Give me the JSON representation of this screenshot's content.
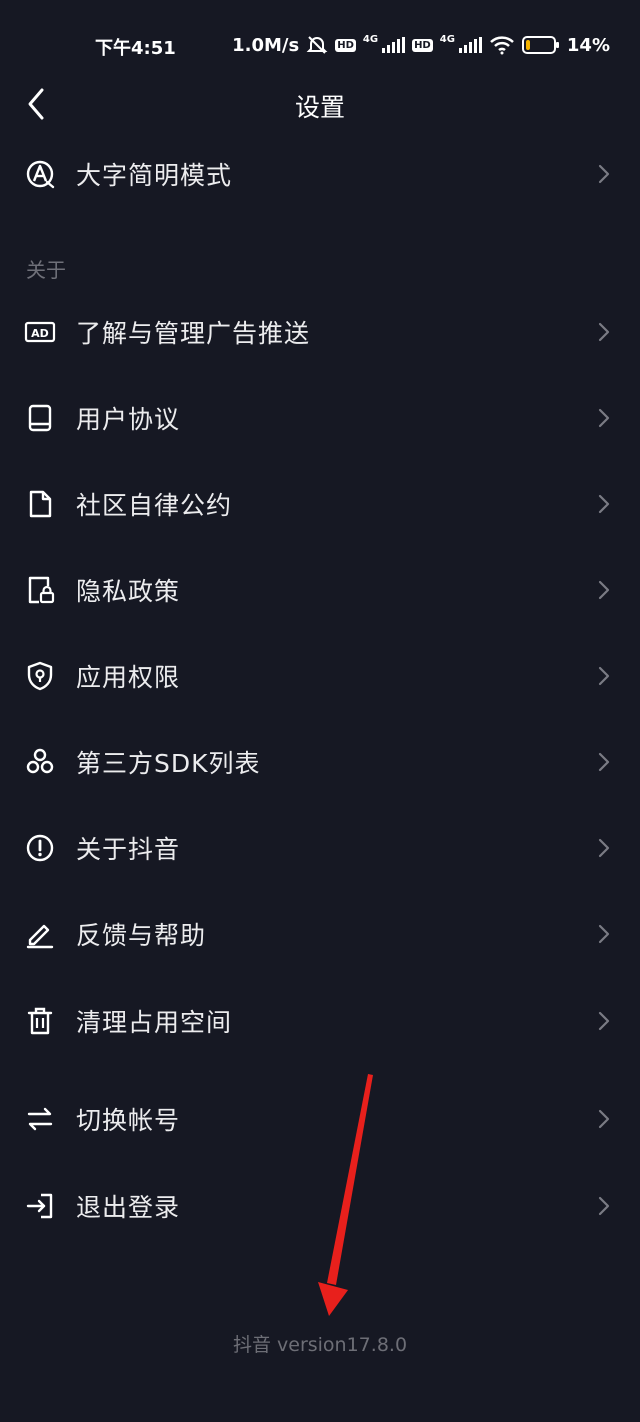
{
  "status_bar": {
    "time": "下午4:51",
    "net_speed": "1.0M/s",
    "sim1_label": "4G",
    "sim2_label": "4G",
    "hd_label": "HD",
    "battery": "14%",
    "battery_level": 0.14,
    "battery_color": "#f5b400"
  },
  "header": {
    "title": "设置"
  },
  "rows_top": [
    {
      "label": "大字简明模式",
      "icon": "large-text-icon"
    }
  ],
  "section_about": {
    "label": "关于"
  },
  "rows_about": [
    {
      "label": "了解与管理广告推送",
      "icon": "ad-icon"
    },
    {
      "label": "用户协议",
      "icon": "book-icon"
    },
    {
      "label": "社区自律公约",
      "icon": "document-icon"
    },
    {
      "label": "隐私政策",
      "icon": "privacy-lock-icon"
    },
    {
      "label": "应用权限",
      "icon": "shield-icon"
    },
    {
      "label": "第三方SDK列表",
      "icon": "sdk-nodes-icon"
    },
    {
      "label": "关于抖音",
      "icon": "info-icon"
    },
    {
      "label": "反馈与帮助",
      "icon": "pencil-icon"
    },
    {
      "label": "清理占用空间",
      "icon": "trash-icon"
    }
  ],
  "rows_account": [
    {
      "label": "切换帐号",
      "icon": "switch-icon"
    },
    {
      "label": "退出登录",
      "icon": "logout-icon"
    }
  ],
  "footer": {
    "version": "抖音 version17.8.0"
  },
  "colors": {
    "background": "#161823",
    "annotation_arrow": "#e8201c"
  }
}
